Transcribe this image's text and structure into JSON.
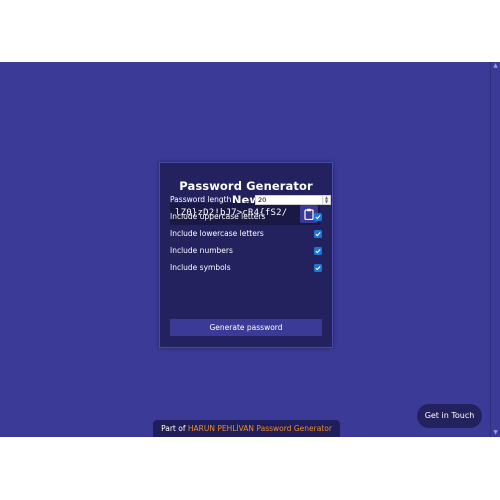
{
  "card": {
    "title": "Password Generator New",
    "generated_password": "lZ0}zD2!bJ7>cR4{fS2/",
    "clipboard_icon": "clipboard-icon"
  },
  "settings": {
    "length_label": "Password length",
    "length_value": "20",
    "options": [
      {
        "label": "Include uppercase letters",
        "checked": true
      },
      {
        "label": "Include lowercase letters",
        "checked": true
      },
      {
        "label": "Include numbers",
        "checked": true
      },
      {
        "label": "Include symbols",
        "checked": true
      }
    ]
  },
  "generate_button": "Generate password",
  "footer": {
    "prefix": "Part of",
    "link_text": "HARUN PEHLİVAN Password Generator"
  },
  "contact_button": "Get in Touch",
  "colors": {
    "background": "#3b3a96",
    "card": "#23215e",
    "checkbox": "#1976d2",
    "link": "#f08c2a"
  }
}
